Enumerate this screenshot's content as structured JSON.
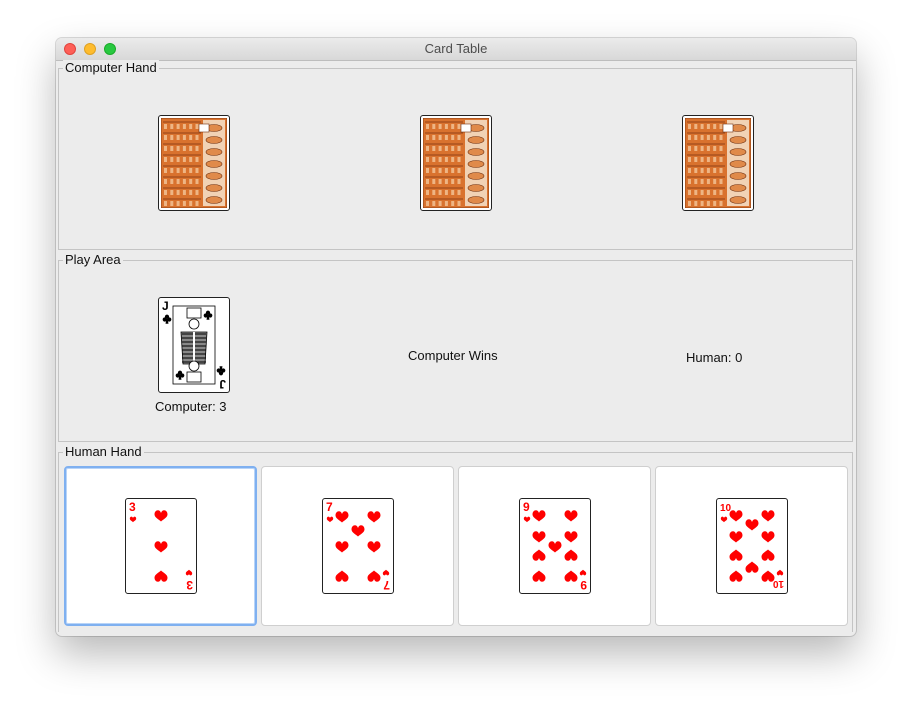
{
  "window": {
    "title": "Card Table"
  },
  "computer_hand": {
    "label": "Computer Hand",
    "cards": [
      {
        "face": "back",
        "icon": "card-back-pattern"
      },
      {
        "face": "back",
        "icon": "card-back-pattern"
      },
      {
        "face": "back",
        "icon": "card-back-pattern"
      }
    ]
  },
  "play_area": {
    "label": "Play Area",
    "played_card": {
      "rank": "J",
      "suit": "clubs",
      "color": "#000000"
    },
    "computer_score": "Computer: 3",
    "result": "Computer Wins",
    "human_score": "Human: 0"
  },
  "human_hand": {
    "label": "Human Hand",
    "selected_index": 0,
    "cards": [
      {
        "rank": "3",
        "suit": "hearts",
        "color": "#ff0000"
      },
      {
        "rank": "7",
        "suit": "hearts",
        "color": "#ff0000"
      },
      {
        "rank": "9",
        "suit": "hearts",
        "color": "#ff0000"
      },
      {
        "rank": "10",
        "suit": "hearts",
        "color": "#ff0000"
      }
    ]
  },
  "colors": {
    "selection_border": "#7fb0f0",
    "heart_red": "#ff0000",
    "card_back": "#d9722e"
  }
}
